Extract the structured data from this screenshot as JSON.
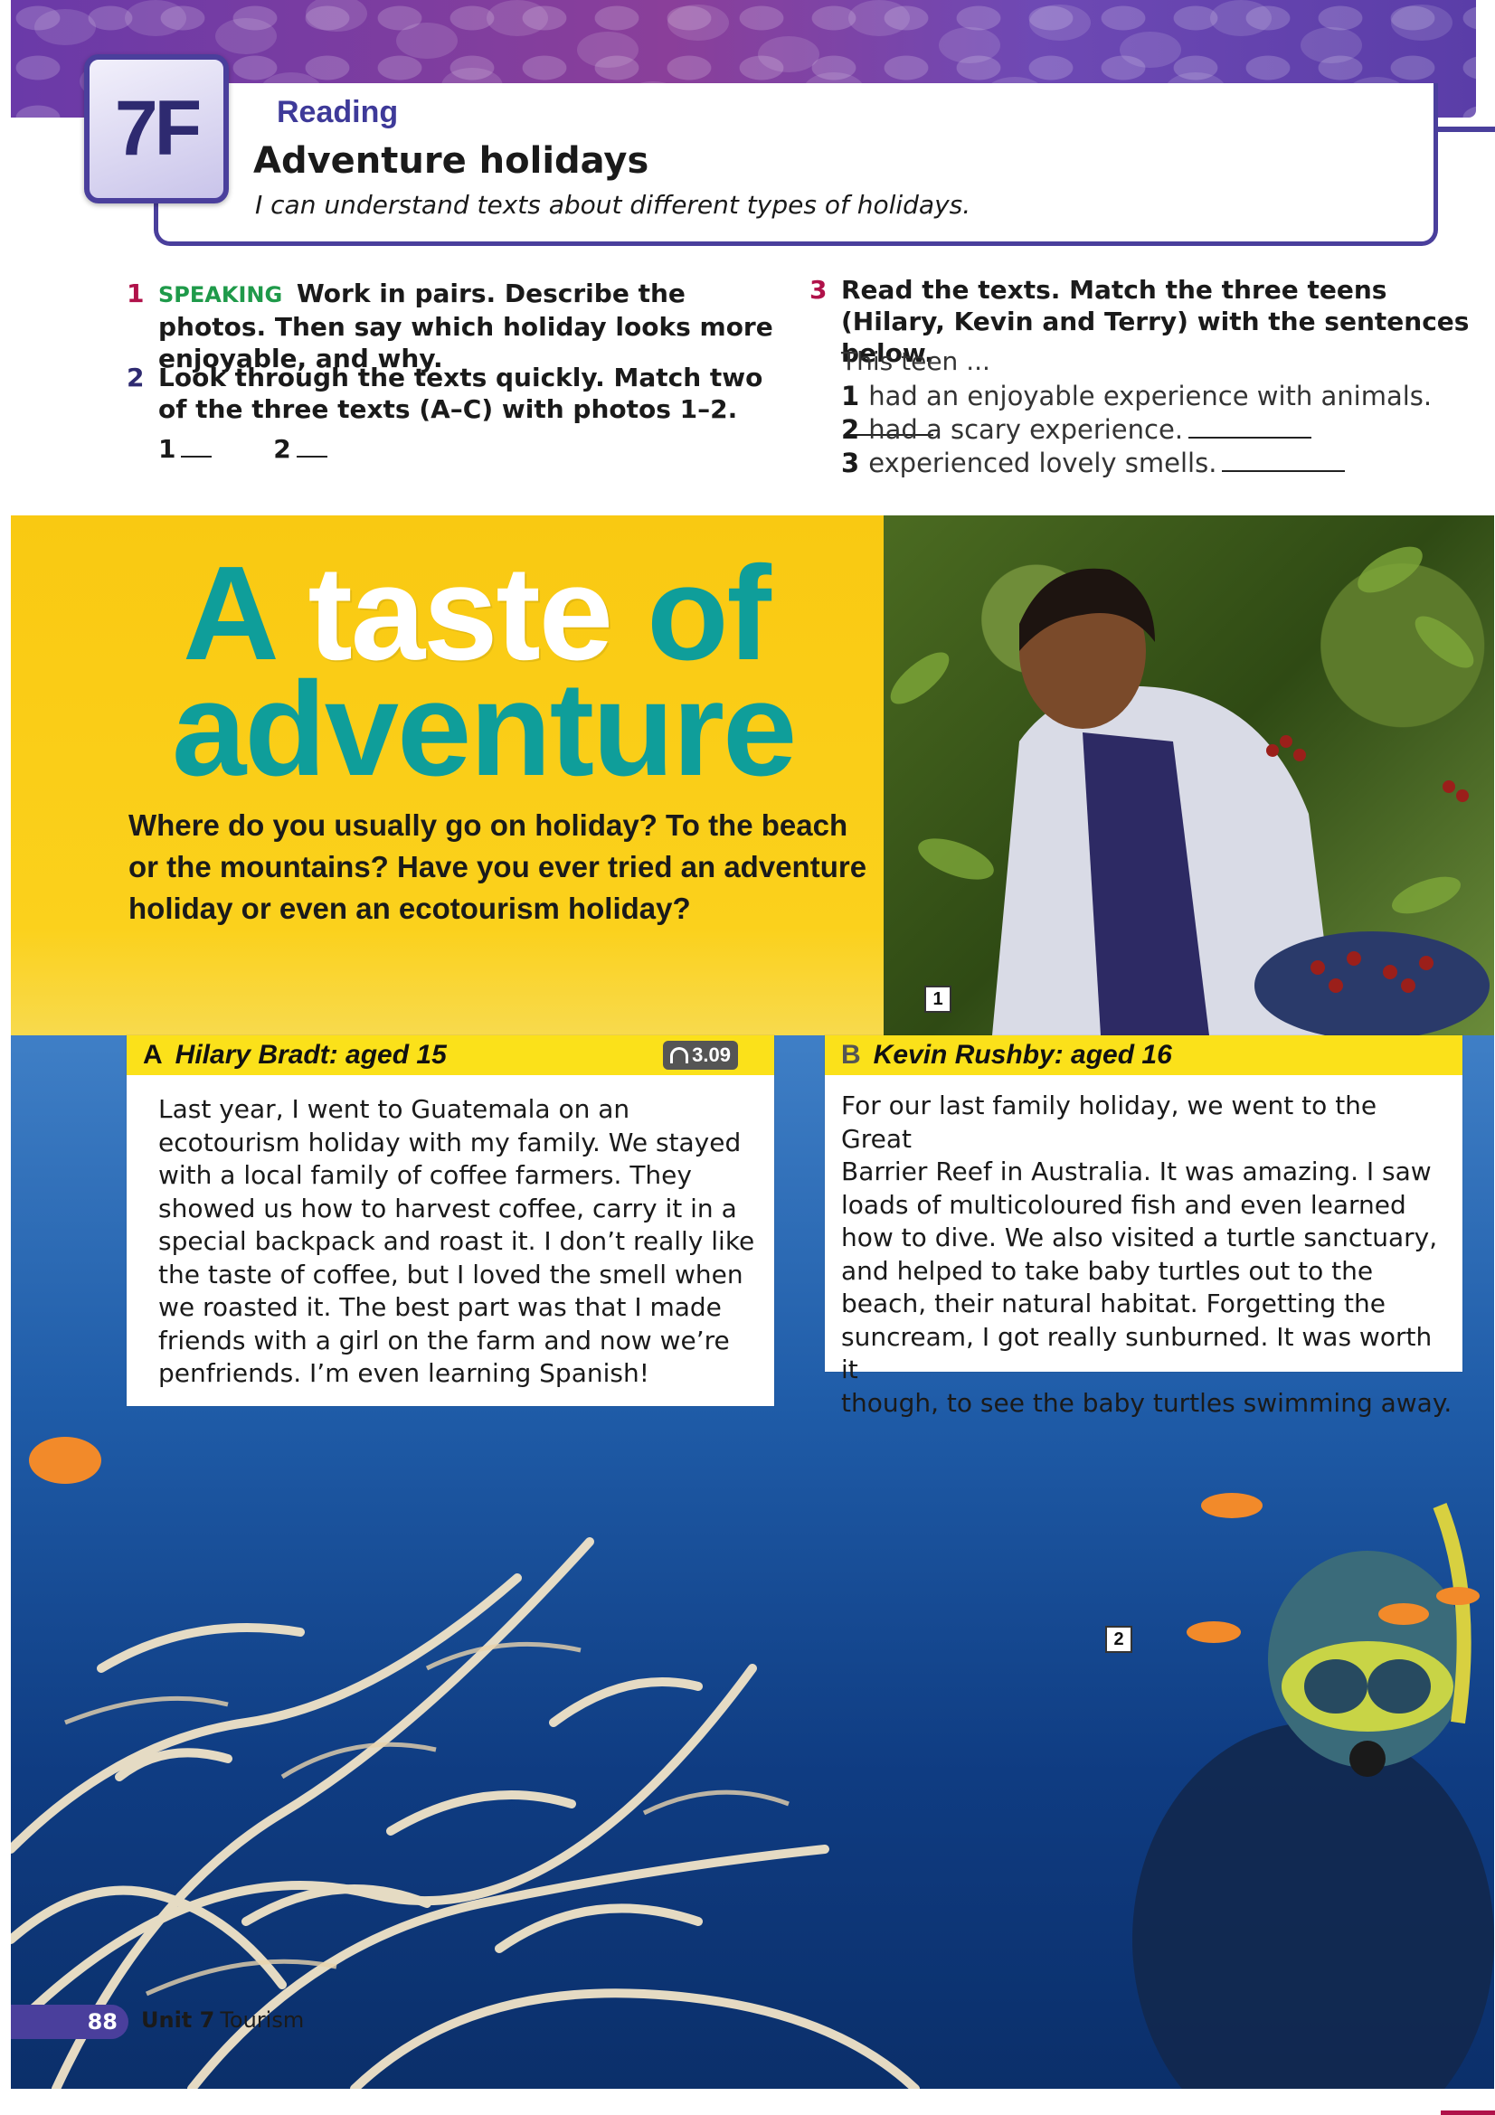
{
  "header": {
    "unit_badge": "7F",
    "section": "Reading",
    "title": "Adventure holidays",
    "subtitle": "I can understand texts about different types of holidays."
  },
  "exercises": {
    "ex1": {
      "num": "1",
      "tag": "SPEAKING",
      "text": "Work in pairs. Describe the photos. Then say which holiday looks more enjoyable, and why."
    },
    "ex2": {
      "num": "2",
      "text": "Look through the texts quickly. Match two of the three texts (A–C) with photos 1–2.",
      "blank1": "1",
      "blank2": "2"
    },
    "ex3": {
      "num": "3",
      "text": "Read the texts. Match the three teens (Hilary, Kevin and Terry) with the sentences below.",
      "intro": "This teen ...",
      "sentences": [
        {
          "num": "1",
          "text": "had an enjoyable experience with animals."
        },
        {
          "num": "2",
          "text": "had a scary experience."
        },
        {
          "num": "3",
          "text": "experienced lovely smells."
        }
      ]
    }
  },
  "feature": {
    "title_word1": "A",
    "title_word2": "taste",
    "title_word3": "of",
    "title_line2": "adventure",
    "intro": "Where do you usually go on holiday? To the beach or the mountains? Have you ever tried an adventure holiday or even an ecotourism holiday?",
    "photo1_label": "1",
    "photo2_label": "2"
  },
  "cards": {
    "a": {
      "letter": "A",
      "name": "Hilary Bradt: aged 15",
      "audio": "3.09",
      "lines": [
        "Last year, I went to Guatemala on an",
        "ecotourism holiday with my family. We stayed",
        "with a local family of coffee farmers. They",
        "showed us how to harvest coffee, carry it in a",
        "special backpack and roast it. I don’t really like",
        "the taste of coffee, but I loved the smell when",
        "we roasted it. The best part was that I made",
        "friends with a girl on the farm and now we’re",
        "penfriends. I’m even learning Spanish!"
      ]
    },
    "b": {
      "letter": "B",
      "name": "Kevin Rushby: aged 16",
      "lines": [
        "For our last family holiday, we went to the Great",
        "Barrier Reef in Australia. It was amazing. I saw",
        "loads of multicoloured fish and even learned",
        "how to dive. We also visited a turtle sanctuary,",
        "and helped to take baby turtles out to the",
        "beach, their natural habitat. Forgetting the",
        "suncream, I got really sunburned. It was worth it",
        "though, to see the baby turtles swimming away."
      ]
    }
  },
  "footer": {
    "page": "88",
    "unit": "Unit 7",
    "topic": "Tourism"
  }
}
